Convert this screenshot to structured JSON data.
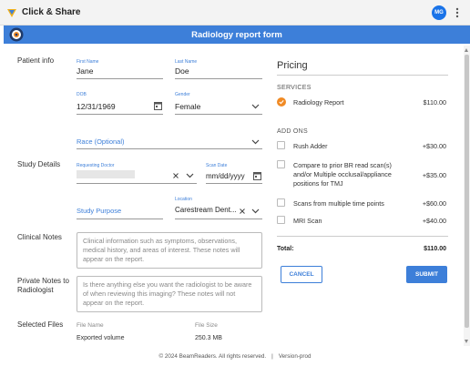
{
  "window": {
    "title": "Click & Share",
    "avatar_initials": "MG"
  },
  "header": {
    "title": "Radiology report form"
  },
  "patient_info": {
    "label": "Patient info",
    "first_name_label": "First Name",
    "first_name": "Jane",
    "last_name_label": "Last Name",
    "last_name": "Doe",
    "dob_label": "DOB",
    "dob": "12/31/1969",
    "gender_label": "Gender",
    "gender": "Female",
    "race_placeholder": "Race (Optional)"
  },
  "study_details": {
    "label": "Study Details",
    "requesting_doctor_label": "Requesting Doctor",
    "scan_date_label": "Scan Date",
    "scan_date_placeholder": "mm/dd/yyyy",
    "study_purpose_placeholder": "Study Purpose",
    "location_label": "Location",
    "location": "Carestream Dent..."
  },
  "clinical_notes": {
    "label": "Clinical Notes",
    "placeholder": "Clinical information such as symptoms, observations, medical history, and areas of interest. These notes will appear on the report."
  },
  "private_notes": {
    "label": "Private Notes to Radiologist",
    "placeholder": "Is there anything else you want the radiologist to be aware of when reviewing this imaging? These notes will not appear on the report."
  },
  "selected_files": {
    "label": "Selected Files",
    "col_name": "File Name",
    "col_size": "File Size",
    "rows": [
      {
        "name": "Exported volume",
        "size": "250.3 MB"
      }
    ]
  },
  "pricing": {
    "title": "Pricing",
    "services_label": "SERVICES",
    "services": [
      {
        "name": "Radiology Report",
        "price": "$110.00",
        "checked": true
      }
    ],
    "addons_label": "ADD ONS",
    "addons": [
      {
        "name": "Rush Adder",
        "price": "+$30.00"
      },
      {
        "name": "Compare to prior BR read scan(s) and/or Multiple occlusal/appliance positions for TMJ",
        "price": "+$35.00"
      },
      {
        "name": "Scans from multiple time points",
        "price": "+$60.00"
      },
      {
        "name": "MRI Scan",
        "price": "+$40.00"
      }
    ],
    "total_label": "Total:",
    "total": "$110.00",
    "cancel_label": "CANCEL",
    "submit_label": "SUBMIT"
  },
  "footer": {
    "copyright": "© 2024 BeamReaders. All rights reserved.",
    "separator": "|",
    "version": "Version-prod"
  },
  "colors": {
    "accent": "#3d7fd9",
    "checked": "#f08a24"
  }
}
